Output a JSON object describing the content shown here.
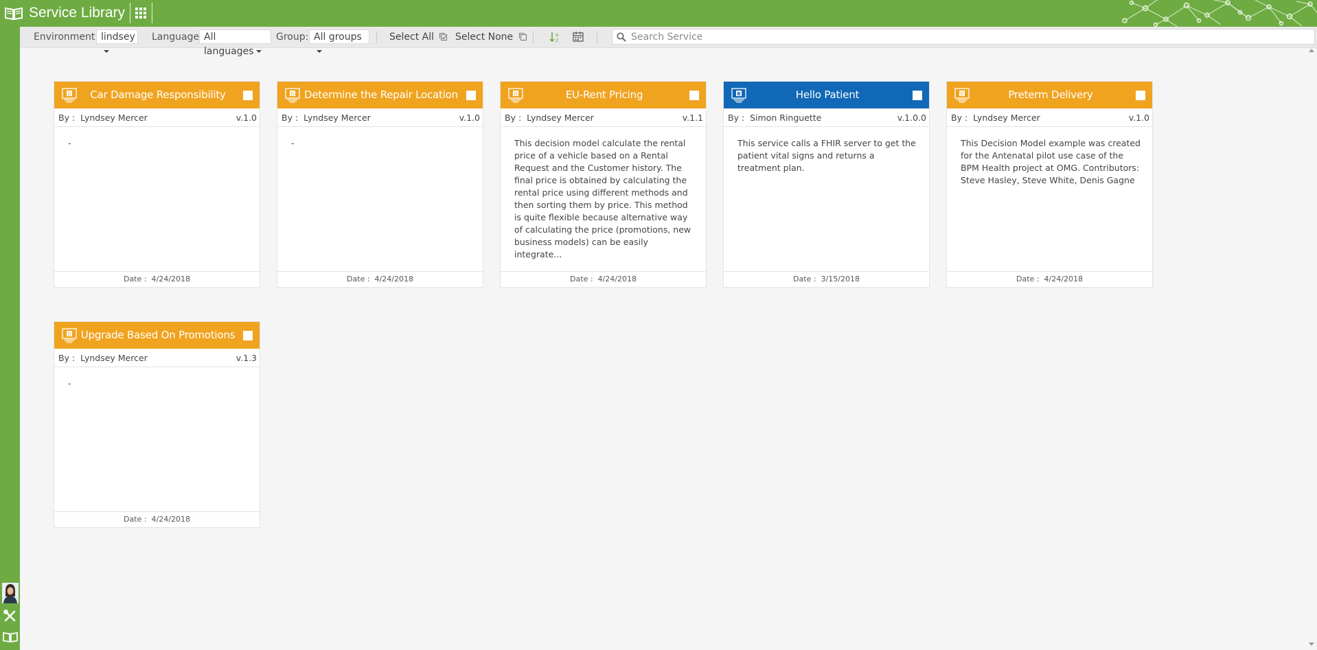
{
  "app": {
    "title": "Service Library"
  },
  "toolbar": {
    "environment_label": "Environment:",
    "environment_value": "lindsey",
    "language_label": "Language:",
    "language_value": "All languages",
    "group_label": "Group:",
    "group_value": "All groups",
    "select_all": "Select All",
    "select_none": "Select None",
    "search_placeholder": "Search Service"
  },
  "cards": [
    {
      "type_icon": "decision-model-icon",
      "type_letter": "D",
      "color": "#f0a31f",
      "title": "Car Damage Responsibility",
      "by_label": "By :",
      "author": "Lyndsey Mercer",
      "version": "v.1.0",
      "description": "-",
      "date_label": "Date :",
      "date": "4/24/2018"
    },
    {
      "type_icon": "decision-model-icon",
      "type_letter": "D",
      "color": "#f0a31f",
      "title": "Determine the Repair Location",
      "by_label": "By :",
      "author": "Lyndsey Mercer",
      "version": "v.1.0",
      "description": "-",
      "date_label": "Date :",
      "date": "4/24/2018"
    },
    {
      "type_icon": "decision-model-icon",
      "type_letter": "D",
      "color": "#f0a31f",
      "title": "EU-Rent Pricing",
      "by_label": "By :",
      "author": "Lyndsey Mercer",
      "version": "v.1.1",
      "description": "This decision model calculate the rental price of a vehicle based on a Rental Request and the Customer history.  The final price is obtained by calculating the rental price using different methods and then sorting them by price. This method is quite flexible because alternative way of calculating the price (promotions, new business models) can be easily integrate...",
      "date_label": "Date :",
      "date": "4/24/2018"
    },
    {
      "type_icon": "business-process-icon",
      "type_letter": "B",
      "color": "#1168b6",
      "title": "Hello Patient",
      "by_label": "By :",
      "author": "Simon Ringuette",
      "version": "v.1.0.0",
      "description": "This service calls a FHIR server to get the patient vital signs and returns a treatment plan.",
      "date_label": "Date :",
      "date": "3/15/2018"
    },
    {
      "type_icon": "decision-model-icon",
      "type_letter": "D",
      "color": "#f0a31f",
      "title": "Preterm Delivery",
      "by_label": "By :",
      "author": "Lyndsey Mercer",
      "version": "v.1.0",
      "description": "This Decision Model example was created for the Antenatal pilot use case of the BPM Health project at OMG. Contributors: Steve Hasley, Steve White, Denis Gagne",
      "date_label": "Date :",
      "date": "4/24/2018"
    },
    {
      "type_icon": "decision-model-icon",
      "type_letter": "D",
      "color": "#f0a31f",
      "title": "Upgrade Based On Promotions",
      "by_label": "By :",
      "author": "Lyndsey Mercer",
      "version": "v.1.3",
      "description": "-",
      "date_label": "Date :",
      "date": "4/24/2018"
    }
  ],
  "colors": {
    "brand_green": "#6eab43",
    "decision_orange": "#f0a31f",
    "process_blue": "#1168b6"
  }
}
